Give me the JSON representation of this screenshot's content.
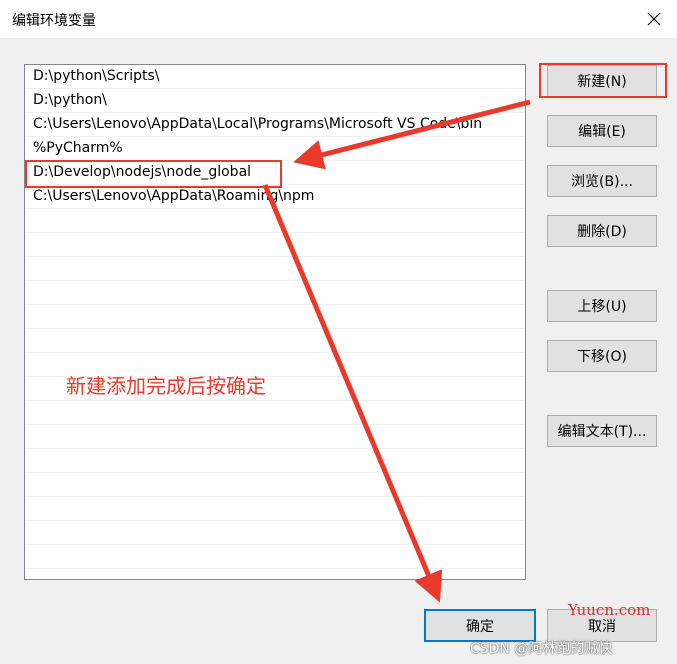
{
  "window": {
    "title": "编辑环境变量"
  },
  "list": {
    "items": [
      "D:\\python\\Scripts\\",
      "D:\\python\\",
      "C:\\Users\\Lenovo\\AppData\\Local\\Programs\\Microsoft VS Code\\bin",
      "%PyCharm%",
      "D:\\Develop\\nodejs\\node_global",
      "C:\\Users\\Lenovo\\AppData\\Roaming\\npm"
    ]
  },
  "buttons": {
    "new": "新建(N)",
    "edit": "编辑(E)",
    "browse": "浏览(B)...",
    "delete": "删除(D)",
    "move_up": "上移(U)",
    "move_down": "下移(O)",
    "edit_text": "编辑文本(T)...",
    "ok": "确定",
    "cancel": "取消"
  },
  "annotation": {
    "text": "新建添加完成后按确定",
    "color": "#e8392b"
  },
  "watermark": {
    "site": "Yuucn.com",
    "author": "CSDN @阿林跑的贼快"
  },
  "icons": {
    "close": "close-icon"
  }
}
